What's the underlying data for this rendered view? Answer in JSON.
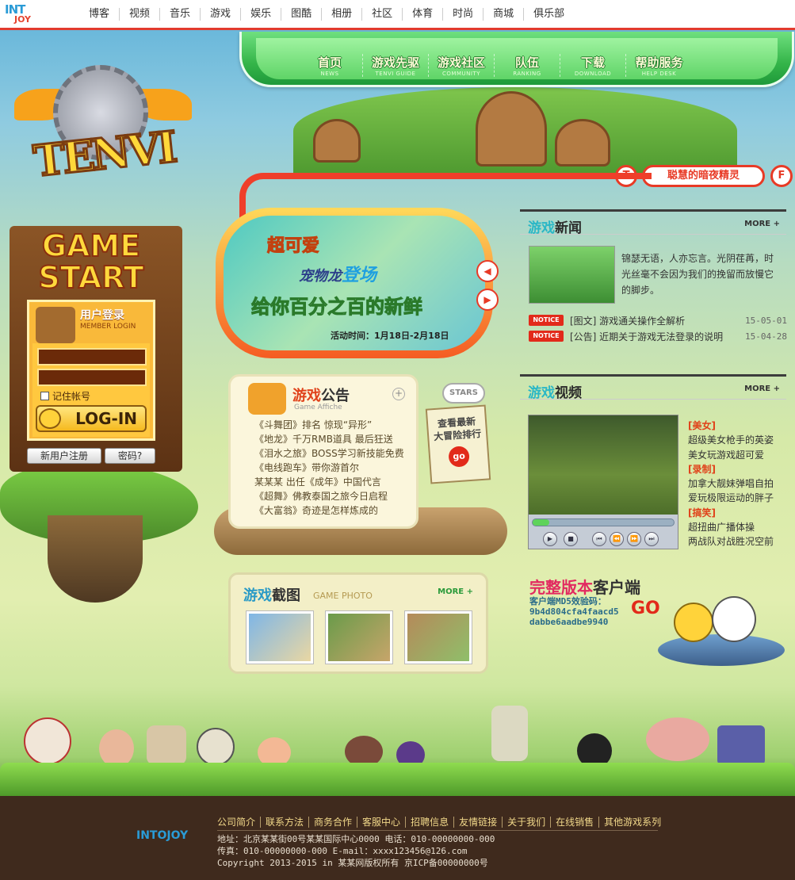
{
  "top_nav": {
    "logo_line1": "INT",
    "logo_line2": "JOY",
    "links": [
      "博客",
      "视频",
      "音乐",
      "游戏",
      "娱乐",
      "图酷",
      "相册",
      "社区",
      "体育",
      "时尚",
      "商城",
      "俱乐部"
    ]
  },
  "main_menu": [
    {
      "cn": "首页",
      "en": "NEWS"
    },
    {
      "cn": "游戏先驱",
      "en": "TENVI GUIDE"
    },
    {
      "cn": "游戏社区",
      "en": "COMMUNITY"
    },
    {
      "cn": "队伍",
      "en": "RANKING"
    },
    {
      "cn": "下载",
      "en": "DOWNLOAD"
    },
    {
      "cn": "帮助服务",
      "en": "HELP DESK"
    }
  ],
  "game_logo": "TENVI",
  "tag_pill": {
    "text": "聪慧的暗夜精灵",
    "left_dot": "T",
    "right_dot": "F"
  },
  "login": {
    "header": "GAME START",
    "title": "用户登录",
    "subtitle": "MEMBER LOGIN",
    "remember": "记住帐号",
    "login_btn": "LOG-IN",
    "register_btn": "新用户注册",
    "password_btn": "密码?"
  },
  "banner": {
    "line1": "超可爱",
    "line2a": "宠物龙",
    "line2b": "登场",
    "line3": "给你百分之百的新鲜",
    "time": "活动时间：1月18日-2月18日"
  },
  "news": {
    "title_a": "游戏",
    "title_b": "新闻",
    "more": "MORE +",
    "intro": "锦瑟无语，人亦忘言。光阴荏苒，时光丝毫不会因为我们的挽留而放慢它的脚步。",
    "notice_label": "NOTICE",
    "items": [
      {
        "title": "[图文] 游戏通关操作全解析",
        "date": "15-05-01"
      },
      {
        "title": "[公告] 近期关于游戏无法登录的说明",
        "date": "15-04-28"
      }
    ]
  },
  "video": {
    "title_a": "游戏",
    "title_b": "视频",
    "more": "MORE +",
    "progress": 0.12,
    "controls": [
      "play-icon",
      "stop-icon",
      "prev-icon",
      "rewind-icon",
      "forward-icon",
      "next-icon"
    ],
    "groups": [
      {
        "cat": "[美女]",
        "items": [
          "超级美女枪手的英姿",
          "美女玩游戏超可爱"
        ]
      },
      {
        "cat": "[录制]",
        "items": [
          "加拿大靓妹弹唱自拍",
          "爱玩极限运动的胖子"
        ]
      },
      {
        "cat": "[搞笑]",
        "items": [
          "超扭曲广播体操",
          "两战队对战胜况空前"
        ]
      }
    ]
  },
  "client": {
    "title_a": "完整版本",
    "title_b": "客户端",
    "md5_label": "客户端MD5效验码：",
    "md5_1": "9b4d804cfa4faacd5",
    "md5_2": "dabbe6aadbe9940",
    "go": "GO"
  },
  "affiche": {
    "title_a": "游戏",
    "title_b": "公告",
    "subtitle": "Game Affiche",
    "items": [
      "《斗舞团》排名 惊现“异形”",
      "《地龙》千万RMB道具 最后狂送",
      "《泪水之旅》BOSS学习新技能免费",
      "《电线跑车》带你游首尔",
      "某某某 出任《成年》中国代言",
      "《超舞》佛教泰国之旅今日启程",
      "《大富翁》奇迹是怎样炼成的"
    ]
  },
  "ranking": {
    "stars": "STARS",
    "line1": "查看最新",
    "line2": "大冒险排行",
    "go": "go"
  },
  "photo": {
    "title_a": "游戏",
    "title_b": "截图",
    "subtitle": "GAME PHOTO",
    "more": "MORE +"
  },
  "footer": {
    "links": [
      "公司简介",
      "联系方法",
      "商务合作",
      "客服中心",
      "招聘信息",
      "友情链接",
      "关于我们",
      "在线销售",
      "其他游戏系列"
    ],
    "address": "地址：北京某某街00号某某国际中心0000 电话：010-00000000-000",
    "fax": "传真：010-00000000-000 E-mail：xxxx123456@126.com",
    "copyright": "Copyright 2013-2015 in 某某网版权所有 京ICP备00000000号",
    "logo": "INTOJOY"
  }
}
